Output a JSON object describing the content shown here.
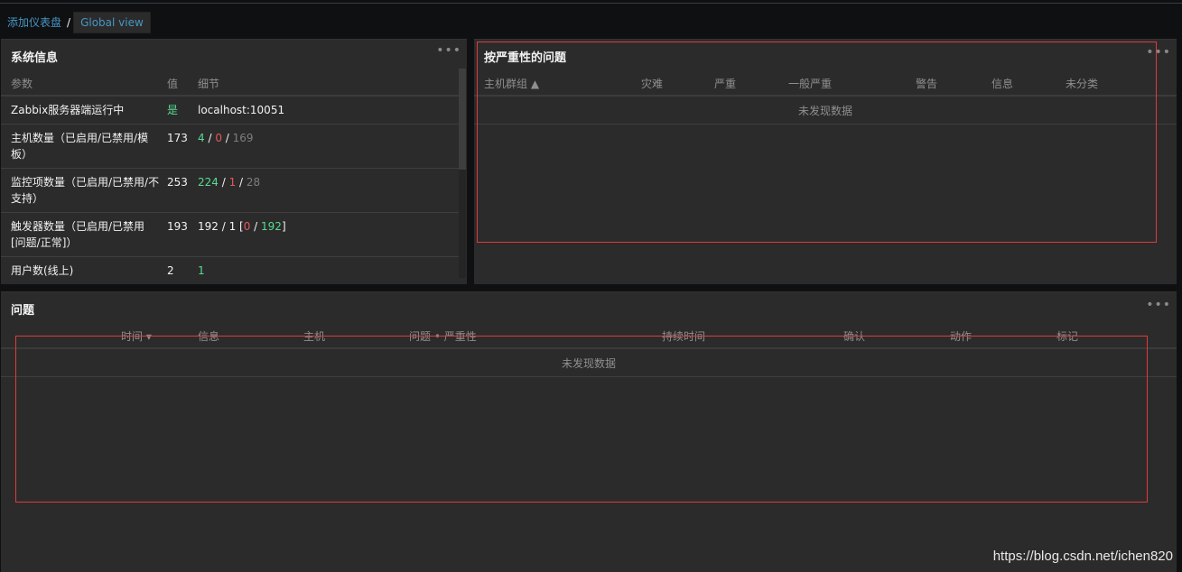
{
  "breadcrumb": {
    "root": "添加仪表盘",
    "separator": "/",
    "current": "Global view"
  },
  "system_info": {
    "title": "系统信息",
    "headers": {
      "param": "参数",
      "value": "值",
      "detail": "细节"
    },
    "rows": [
      {
        "param": "Zabbix服务器端运行中",
        "value": "是",
        "detail": "localhost:10051"
      },
      {
        "param": "主机数量（已启用/已禁用/模板）",
        "value": "173",
        "detail": {
          "a": "4",
          "b": "0",
          "c": "169"
        }
      },
      {
        "param": "监控项数量（已启用/已禁用/不支持）",
        "value": "253",
        "detail": {
          "a": "224",
          "b": "1",
          "c": "28"
        }
      },
      {
        "param": "触发器数量（已启用/已禁用[问题/正常]）",
        "value": "193",
        "detail": {
          "a": "192",
          "b": "1",
          "c": "0",
          "d": "192"
        }
      },
      {
        "param": "用户数(线上)",
        "value": "2",
        "detail": "1"
      }
    ]
  },
  "problems_by_severity": {
    "title": "按严重性的问题",
    "headers": [
      "主机群组 ▲",
      "灾难",
      "严重",
      "一般严重",
      "警告",
      "信息",
      "未分类"
    ],
    "no_data": "未发现数据"
  },
  "problems": {
    "title": "问题",
    "headers": [
      "时间 ▾",
      "信息",
      "主机",
      "问题 • 严重性",
      "持续时间",
      "确认",
      "动作",
      "标记"
    ],
    "no_data": "未发现数据"
  },
  "colors": {
    "ok_green": "#59db8f",
    "problem_red": "#e45959",
    "link_blue": "#4796c4",
    "highlight_box": "#e03a3a"
  },
  "icons": {
    "menu": "more-dots-icon"
  },
  "watermark": "https://blog.csdn.net/ichen820"
}
